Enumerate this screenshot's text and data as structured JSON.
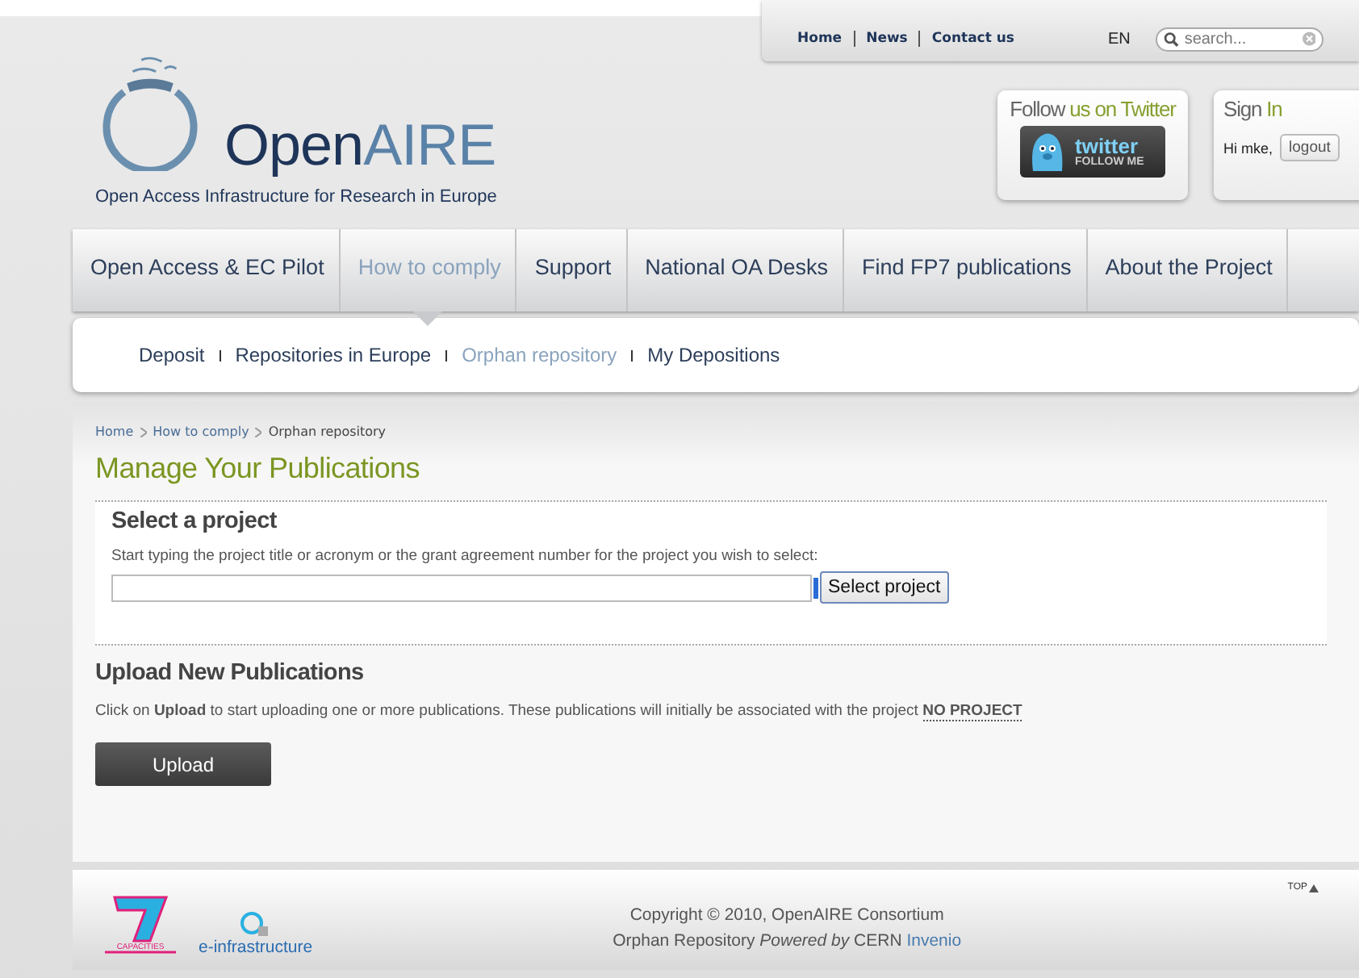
{
  "top_links": [
    {
      "label": "Home"
    },
    {
      "label": "News"
    },
    {
      "label": "Contact us"
    }
  ],
  "language": "EN",
  "search": {
    "placeholder": "search..."
  },
  "logo": {
    "name_dark": "Open",
    "name_light": "AIRE",
    "tagline": "Open Access Infrastructure for Research in Europe"
  },
  "twitter": {
    "title": "Follow",
    "title_accent": "us on Twitter",
    "badge_word": "twitter",
    "badge_caption": "FOLLOW ME"
  },
  "signin": {
    "title": "Sign",
    "title_accent": "In",
    "greeting": "Hi mke,",
    "button": "logout"
  },
  "nav": [
    {
      "label": "Open Access & EC Pilot",
      "selected": false
    },
    {
      "label": "How to comply",
      "selected": true
    },
    {
      "label": "Support",
      "selected": false
    },
    {
      "label": "National OA Desks",
      "selected": false
    },
    {
      "label": "Find FP7 publications",
      "selected": false
    },
    {
      "label": "About the Project",
      "selected": false
    }
  ],
  "subnav": [
    {
      "label": "Deposit",
      "selected": false
    },
    {
      "label": "Repositories in Europe",
      "selected": false
    },
    {
      "label": "Orphan repository",
      "selected": true
    },
    {
      "label": "My Depositions",
      "selected": false
    }
  ],
  "breadcrumb": [
    {
      "label": "Home",
      "kind": "link"
    },
    {
      "label": "How to comply",
      "kind": "link"
    },
    {
      "label": "Orphan repository",
      "kind": "current"
    }
  ],
  "page_title": "Manage Your Publications",
  "select_project": {
    "heading": "Select a project",
    "instruction": "Start typing the project title or acronym or the grant agreement number for the project you wish to select:",
    "button": "Select project"
  },
  "upload": {
    "heading": "Upload New Publications",
    "text": "Click on **Upload** to start uploading one or more publications. These publications will initially be associated with the project",
    "project": "NO PROJECT",
    "button": "Upload"
  },
  "footer": {
    "top_link": "TOP",
    "copyright": "Copyright © 2010, OpenAIRE Consortium",
    "powered_prefix": "Orphan Repository",
    "powered_by": "Powered by",
    "powered_org": "CERN",
    "powered_link": "Invenio",
    "fp7_caption": "CAPACITIES",
    "einfra": "e-infrastructure"
  }
}
